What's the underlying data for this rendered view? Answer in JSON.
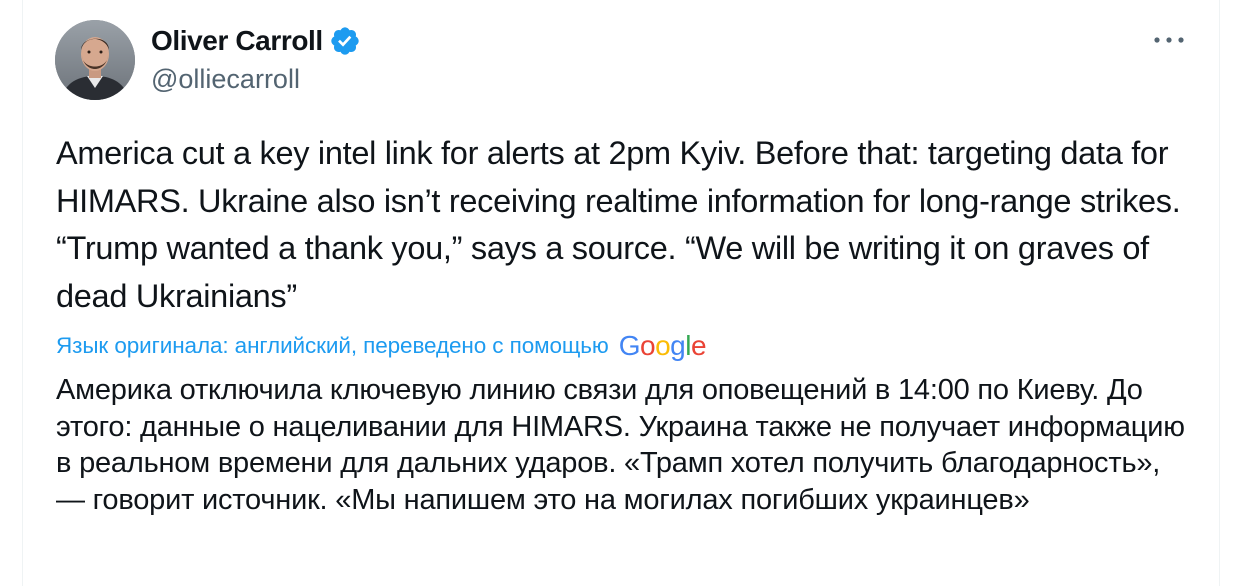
{
  "author": {
    "display_name": "Oliver Carroll",
    "handle": "@olliecarroll",
    "verified": true
  },
  "icons": {
    "verified": "verified-badge-icon",
    "more": "more-options-icon",
    "avatar": "profile-photo"
  },
  "tweet": {
    "text": "America cut a key intel link for alerts at 2pm Kyiv. Before that: targeting data for HIMARS. Ukraine also isn’t receiving realtime information for long-range strikes. “Trump wanted a thank you,” says a source. “We will be writing it on graves of dead Ukrainians”"
  },
  "translation": {
    "label": "Язык оригинала: английский, переведено с помощью",
    "provider": "Google",
    "text": "Америка отключила ключевую линию связи для оповещений в 14:00 по Киеву. До этого: данные о нацеливании для HIMARS. Украина также не получает информацию в реальном времени для дальних ударов. «Трамп хотел получить благодарность», — говорит источник. «Мы напишем это на могилах погибших украинцев»"
  },
  "colors": {
    "text_primary": "#0f1419",
    "text_secondary": "#536471",
    "accent": "#1d9bf0"
  }
}
